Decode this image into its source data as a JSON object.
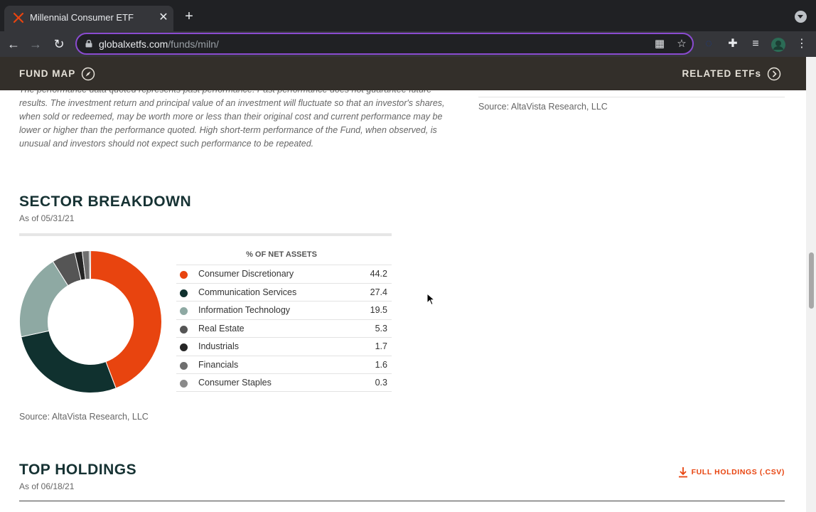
{
  "browser": {
    "tab_title": "Millennial Consumer ETF",
    "url_domain": "globalxetfs.com",
    "url_path": "/funds/miln/"
  },
  "sticky_nav": {
    "fund_map": "FUND MAP",
    "related": "RELATED ETFs"
  },
  "performance_disclaimer": "The performance data quoted represents past performance. Past performance does not guarantee future results. The investment return and principal value of an investment will fluctuate so that an investor's shares, when sold or redeemed, may be worth more or less than their original cost and current performance may be lower or higher than the performance quoted. High short-term performance of the Fund, when observed, is unusual and investors should not expect such performance to be repeated.",
  "source_top_right": "Source: AltaVista Research, LLC",
  "sector_breakdown": {
    "title": "SECTOR BREAKDOWN",
    "as_of": "As of 05/31/21",
    "table_header": "% OF NET ASSETS",
    "source": "Source: AltaVista Research, LLC"
  },
  "chart_data": {
    "type": "pie",
    "donut": true,
    "categories": [
      "Consumer Discretionary",
      "Communication Services",
      "Information Technology",
      "Real Estate",
      "Industrials",
      "Financials",
      "Consumer Staples"
    ],
    "values": [
      44.2,
      27.4,
      19.5,
      5.3,
      1.7,
      1.6,
      0.3
    ],
    "colors": [
      "#e8440f",
      "#10312f",
      "#8ea9a3",
      "#555555",
      "#262626",
      "#6f6f6f",
      "#8a8a8a"
    ],
    "value_labels": [
      "44.2",
      "27.4",
      "19.5",
      "5.3",
      "1.7",
      "1.6",
      "0.3"
    ]
  },
  "top_holdings": {
    "title": "TOP HOLDINGS",
    "as_of": "As of 06/18/21",
    "csv_label": "FULL HOLDINGS (.CSV)"
  },
  "colors": {
    "accent": "#e8440f",
    "heading": "#163233",
    "nav_bar": "#332f2a"
  }
}
